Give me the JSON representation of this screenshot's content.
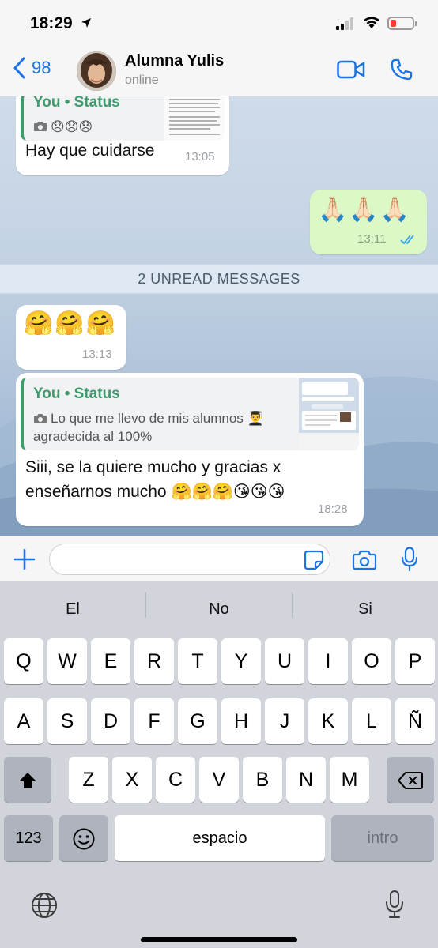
{
  "status_bar": {
    "time": "18:29"
  },
  "header": {
    "back_count": "98",
    "contact_name": "Alumna Yulis",
    "contact_status": "online"
  },
  "messages": [
    {
      "reply_author": "You • Status",
      "reply_text": "😞😞😞",
      "text": "Hay que cuidarse",
      "time": "13:05",
      "direction": "in"
    },
    {
      "text": "🙏🏻🙏🏻🙏🏻",
      "time": "13:11",
      "direction": "out",
      "read": true
    },
    {
      "text": "🤗🤗🤗",
      "time": "13:13",
      "direction": "in"
    },
    {
      "reply_author": "You • Status",
      "reply_text": "Lo que me llevo de mis alumnos 👨‍🎓 agradecida al 100%",
      "text": "Siii, se la quiere mucho y gracias x enseñarnos mucho 🤗🤗🤗😘😘😘",
      "time": "18:28",
      "direction": "in"
    }
  ],
  "unread_banner": "2 UNREAD MESSAGES",
  "composer": {
    "value": ""
  },
  "keyboard": {
    "suggestions": [
      "El",
      "No",
      "Si"
    ],
    "row1": [
      "Q",
      "W",
      "E",
      "R",
      "T",
      "Y",
      "U",
      "I",
      "O",
      "P"
    ],
    "row2": [
      "A",
      "S",
      "D",
      "F",
      "G",
      "H",
      "J",
      "K",
      "L",
      "Ñ"
    ],
    "row3": [
      "Z",
      "X",
      "C",
      "V",
      "B",
      "N",
      "M"
    ],
    "numbers_label": "123",
    "space_label": "espacio",
    "return_label": "intro"
  },
  "colors": {
    "accent": "#1a73e8",
    "outgoing_bubble": "#dcf8c6",
    "reply_author": "#3d9b6c"
  }
}
